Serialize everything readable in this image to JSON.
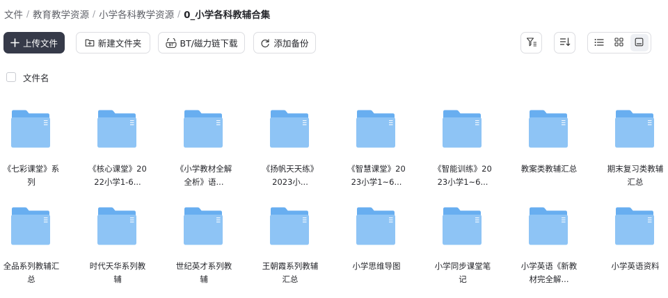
{
  "breadcrumb": [
    {
      "label": "文件"
    },
    {
      "label": "教育教学资源"
    },
    {
      "label": "小学各科教学资源"
    },
    {
      "label": "0_小学各科教辅合集"
    }
  ],
  "toolbar": {
    "upload_label": "上传文件",
    "new_folder_label": "新建文件夹",
    "bt_label": "BT/磁力链下载",
    "backup_label": "添加备份"
  },
  "list_header": {
    "name_column": "文件名"
  },
  "folders": [
    {
      "name": "《七彩课堂》系列"
    },
    {
      "name": "《核心课堂》2022小学1-6..."
    },
    {
      "name": "《小学教材全解全析》语..."
    },
    {
      "name": "《扬帆天天练》2023小..."
    },
    {
      "name": "《智慧课堂》2023小学1~6..."
    },
    {
      "name": "《智能训练》2023小学1~6..."
    },
    {
      "name": "教案类教辅汇总"
    },
    {
      "name": "期末复习类教辅汇总"
    },
    {
      "name": "全品系列教辅汇总"
    },
    {
      "name": "时代天华系列教辅"
    },
    {
      "name": "世纪英才系列教辅"
    },
    {
      "name": "王朝霞系列教辅汇总"
    },
    {
      "name": "小学思维导图"
    },
    {
      "name": "小学同步课堂笔记"
    },
    {
      "name": "小学英语《新教材完全解..."
    },
    {
      "name": "小学英语资料"
    }
  ],
  "colors": {
    "primary": "#363a49",
    "folder_front": "#8ec4f5",
    "folder_back": "#68aef0"
  },
  "icons": {
    "upload": "plus-icon",
    "new_folder": "folder-plus-icon",
    "bt": "bt-icon",
    "backup": "sync-icon",
    "filter": "filter-icon",
    "sort": "sort-icon",
    "view_list": "list-view-icon",
    "view_grid": "grid-view-icon",
    "view_thumb": "thumbnail-view-icon"
  }
}
